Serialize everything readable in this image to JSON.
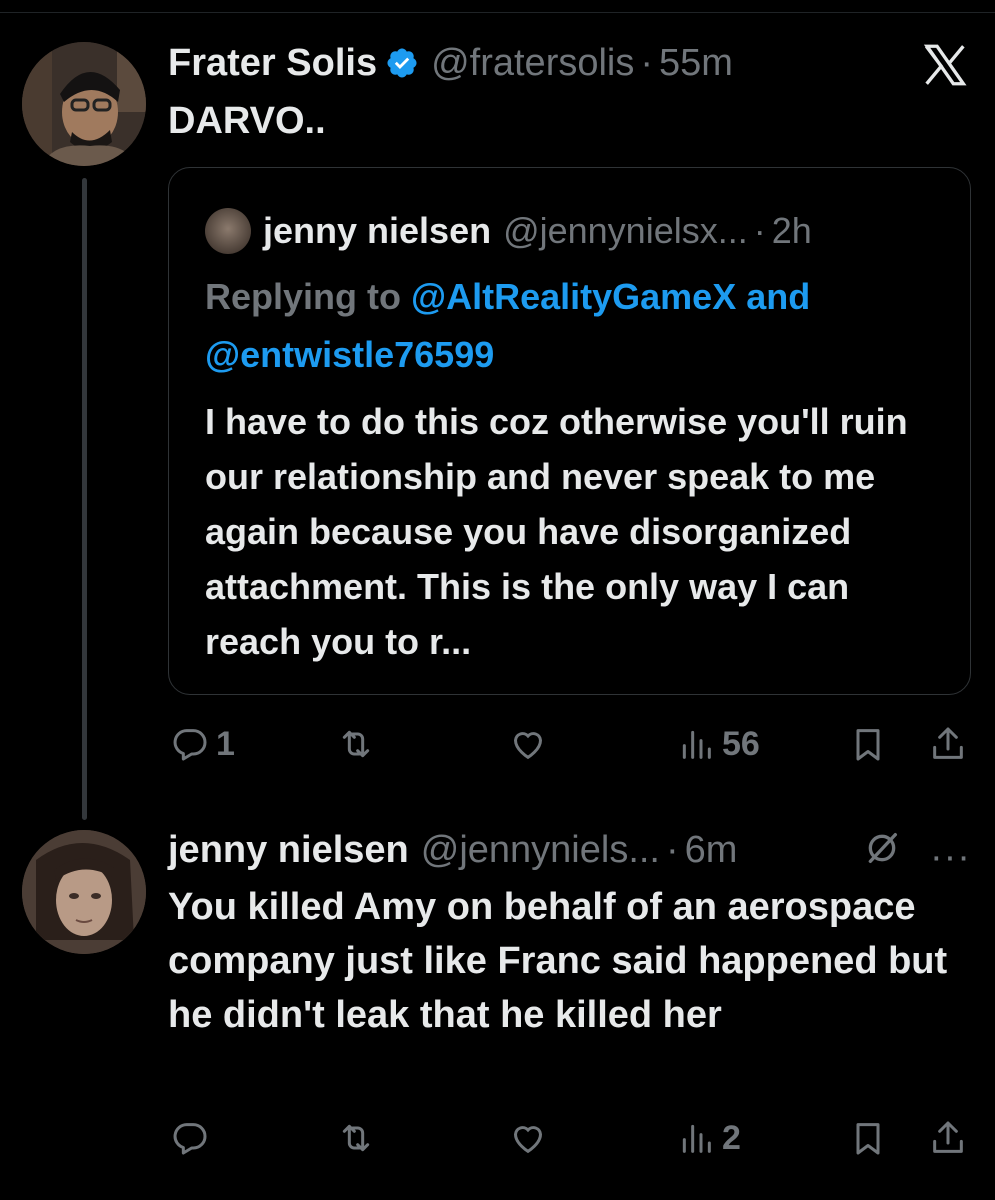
{
  "post1": {
    "name": "Frater Solis",
    "handle": "@fratersolis",
    "separator": "·",
    "time": "55m",
    "text": "DARVO..",
    "quote": {
      "name": "jenny nielsen",
      "handle": "@jennynielsx...",
      "separator": "·",
      "time": "2h",
      "replying_prefix": "Replying to ",
      "replying_user1": "@AltRealityGameX",
      "replying_and": " and",
      "replying_user2": "@entwistle76599",
      "text": "I have to do this coz otherwise you'll ruin our relationship and never speak to me again because you have disorganized attachment. This is the only way I can reach you to r..."
    },
    "actions": {
      "replies": "1",
      "reposts": "",
      "likes": "",
      "views": "56"
    }
  },
  "post2": {
    "name": "jenny nielsen",
    "handle": "@jennyniels...",
    "separator": "·",
    "time": "6m",
    "more": "···",
    "text": "You killed Amy on behalf of an aerospace company just like Franc said happened but he didn't leak that he killed her",
    "actions": {
      "replies": "",
      "reposts": "",
      "likes": "",
      "views": "2"
    }
  },
  "icons": {
    "app": "x-logo-icon",
    "verified": "verified-badge-icon",
    "reply": "reply-icon",
    "repost": "repost-icon",
    "like": "like-icon",
    "views": "views-icon",
    "bookmark": "bookmark-icon",
    "share": "share-icon",
    "grok": "grok-icon"
  },
  "colors": {
    "background": "#000000",
    "text": "#e7e9ea",
    "secondary": "#71767b",
    "link": "#1d9bf0",
    "verified": "#1d9bf0"
  }
}
